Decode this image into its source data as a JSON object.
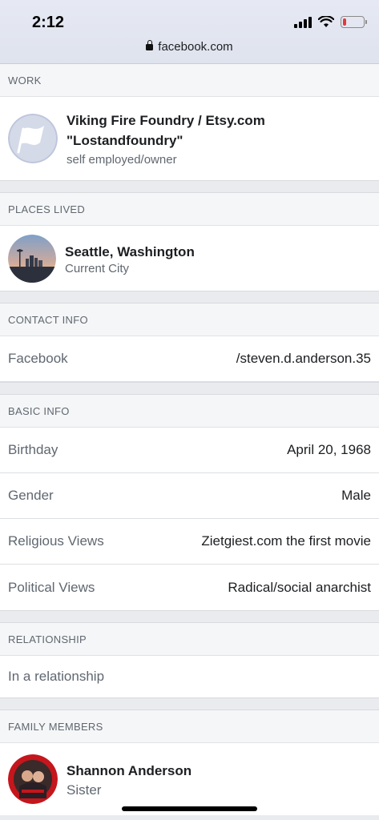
{
  "status_bar": {
    "time": "2:12",
    "url": "facebook.com",
    "battery_level": 0.15,
    "battery_color": "#e0393e",
    "icons": [
      "signal-icon",
      "wifi-icon",
      "battery-icon",
      "lock-icon"
    ]
  },
  "work": {
    "header": "WORK",
    "title": "Viking Fire Foundry / Etsy.com \"Lostandfoundry\"",
    "subtitle": "self employed/owner"
  },
  "places": {
    "header": "PLACES LIVED",
    "title": "Seattle, Washington",
    "subtitle": "Current City"
  },
  "contact": {
    "header": "CONTACT INFO",
    "rows": [
      {
        "label": "Facebook",
        "value": "/steven.d.anderson.35"
      }
    ]
  },
  "basic": {
    "header": "BASIC INFO",
    "rows": [
      {
        "label": "Birthday",
        "value": "April 20, 1968"
      },
      {
        "label": "Gender",
        "value": "Male"
      },
      {
        "label": "Religious Views",
        "value": "Zietgiest.com the first movie"
      },
      {
        "label": "Political Views",
        "value": "Radical/social anarchist"
      }
    ]
  },
  "relationship": {
    "header": "RELATIONSHIP",
    "value": "In a relationship"
  },
  "family": {
    "header": "FAMILY MEMBERS",
    "name": "Shannon Anderson",
    "relation": "Sister"
  }
}
